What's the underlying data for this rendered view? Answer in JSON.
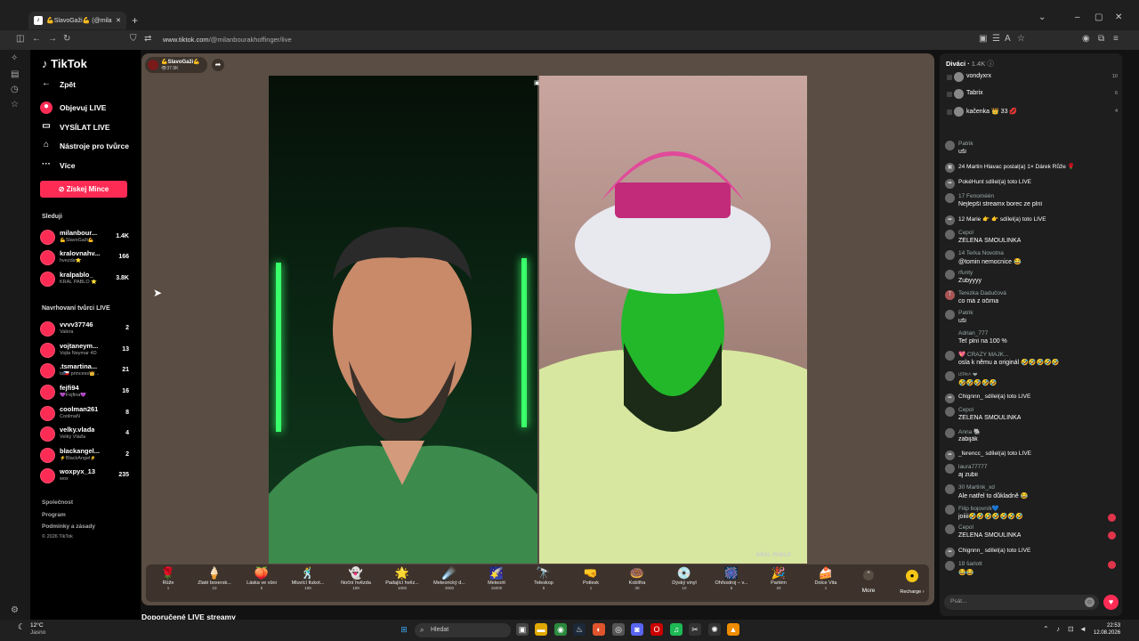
{
  "browser": {
    "tab_title": "💪SlavoGaži💪 (@milanbou",
    "url_host": "www.tiktok.com",
    "url_path": "/@milanbourakhoffinger/live"
  },
  "sidebar": {
    "logo": "TikTok",
    "back": "Zpět",
    "nav": [
      {
        "label": "Objevuj LIVE"
      },
      {
        "label": "VYSÍLAT LIVE"
      },
      {
        "label": "Nástroje pro tvůrce"
      },
      {
        "label": "Více"
      }
    ],
    "coins_button": "Získej Mince",
    "following_title": "Sleduji",
    "following": [
      {
        "name": "milanbour...",
        "sub": "💪SlavoGaži💪",
        "count": "1.4K"
      },
      {
        "name": "kralovnahv...",
        "sub": "hvezda⭐",
        "count": "166"
      },
      {
        "name": "kralpablo_",
        "sub": "KRÁL PABLO ⭐",
        "count": "3.8K"
      }
    ],
    "suggested_title": "Navrhovaní tvůrci LIVE",
    "suggested": [
      {
        "name": "vvvv37746",
        "sub": "Valera",
        "count": "2"
      },
      {
        "name": "vojtaneym...",
        "sub": "Vojta Neymar 4D",
        "count": "13"
      },
      {
        "name": ".tsmartina...",
        "sub": "ts🇨🇿 princess👑...",
        "count": "21"
      },
      {
        "name": "fejfi94",
        "sub": "💜Fejfina💜",
        "count": "16"
      },
      {
        "name": "coolman261",
        "sub": "CoolmaN",
        "count": "8"
      },
      {
        "name": "velky.vlada",
        "sub": "Velký Vláďa",
        "count": "4"
      },
      {
        "name": "blackangel...",
        "sub": "⚡BlackAngel⚡",
        "count": "2"
      },
      {
        "name": "woxpyx_13",
        "sub": "wox",
        "count": "235"
      }
    ],
    "footer": [
      "Společnost",
      "Program",
      "Podmínky a zásady",
      "© 2026 TikTok"
    ]
  },
  "host": {
    "name": "💪SlavoGaži💪",
    "viewers": "👁37.9K"
  },
  "watermark": "KRÁL PABLO",
  "gifts": [
    {
      "icon": "🌹",
      "name": "Růže",
      "price": "1"
    },
    {
      "icon": "🍦",
      "name": "Zlaté boxersk...",
      "price": "10"
    },
    {
      "icon": "🍑",
      "name": "Láska ve vůni",
      "price": "5"
    },
    {
      "icon": "🕺",
      "name": "Mluvící tlukot...",
      "price": "199"
    },
    {
      "icon": "👻",
      "name": "Noční hvězda",
      "price": "199"
    },
    {
      "icon": "🌟",
      "name": "Padající hvěz...",
      "price": "1000"
    },
    {
      "icon": "☄️",
      "name": "Meteorický d...",
      "price": "3000"
    },
    {
      "icon": "🌠",
      "name": "Meteorit",
      "price": "15000"
    },
    {
      "icon": "🔭",
      "name": "Teleskop",
      "price": "5"
    },
    {
      "icon": "🤜",
      "name": "Potlesk",
      "price": "1"
    },
    {
      "icon": "🍩",
      "name": "Koblíha",
      "price": "30"
    },
    {
      "icon": "💿",
      "name": "Dýský vinyl",
      "price": "10"
    },
    {
      "icon": "🎆",
      "name": "Ohňostroj – v...",
      "price": "5"
    },
    {
      "icon": "🎉",
      "name": "Partém",
      "price": "20"
    },
    {
      "icon": "🍰",
      "name": "Dolce Vita",
      "price": "1"
    }
  ],
  "more_label": "More",
  "recharge_label": "Recharge ›",
  "recommended": "Doporučené LIVE streamy",
  "chat": {
    "viewers_title": "Diváci",
    "viewers_count": "1.4K",
    "top": [
      {
        "name": "vondyxrx",
        "score": "10"
      },
      {
        "name": "Tabrix",
        "score": "6"
      },
      {
        "name": "kačenka 👑 33 💋",
        "score": "4"
      }
    ],
    "messages": [
      {
        "name": "Patrik",
        "body": "uši"
      },
      {
        "name": "24 Martin Hlavac poslal(a) 1× Dárek Růže 🌹",
        "body": ""
      },
      {
        "name": "PokéHunt  sdílel(a) toto LIVE",
        "body": ""
      },
      {
        "name": "17 Fenoméèn",
        "body": "Nejlepší streamx borec ze plní"
      },
      {
        "name": "12 Marie 👉 👉 sdílel(a) toto LIVE",
        "body": ""
      },
      {
        "name": "Cepol",
        "body": "ZELENÁ ŠMOULINKA"
      },
      {
        "name": "14 Terka Novotna",
        "body": "@tomin nemocnice 😂"
      },
      {
        "name": "rfunty",
        "body": "Zubyyyy"
      },
      {
        "name": "Terezka Dadučová",
        "body": "co má z očima"
      },
      {
        "name": "Patrik",
        "body": "uši"
      },
      {
        "name": "Adrian_777",
        "body": "Teť plní na 100 %"
      },
      {
        "name": "💖 CRAZY MAJK...",
        "body": "osla k němu a originál 🤣🤣🤣🤣🤣"
      },
      {
        "name": "ᴸᴱᴿᴵᶜᴬ ❤",
        "body": "🤣🤣🤣🤣🤣"
      },
      {
        "name": "Chignnn_  sdílel(a) toto LIVE",
        "body": ""
      },
      {
        "name": "Cepol",
        "body": "ZELENÁ ŠMOULINKA"
      },
      {
        "name": "Anna 🐘",
        "body": "zabiják"
      },
      {
        "name": "_ferencc_  sdílel(a) toto LIVE",
        "body": ""
      },
      {
        "name": "laura77777",
        "body": "aj zubii"
      },
      {
        "name": "30 Martink_xd",
        "body": "Ale natřel to důkladně 😂"
      },
      {
        "name": "Filip bojovník💙",
        "body": "joiiii🤣🤣🤣🤣🤣🤣🤣"
      },
      {
        "name": "Cepol",
        "body": "ZELENÁ ŠMOULINKA"
      },
      {
        "name": "Chignnn_  sdílel(a) toto LIVE",
        "body": ""
      },
      {
        "name": "19 šarlott",
        "body": "😂😂"
      }
    ],
    "input_placeholder": "Psát..."
  },
  "taskbar": {
    "weather_temp": "12°C",
    "weather_desc": "Jasno",
    "search": "Hledat",
    "time": "22:53",
    "date": "12.08.2026"
  }
}
